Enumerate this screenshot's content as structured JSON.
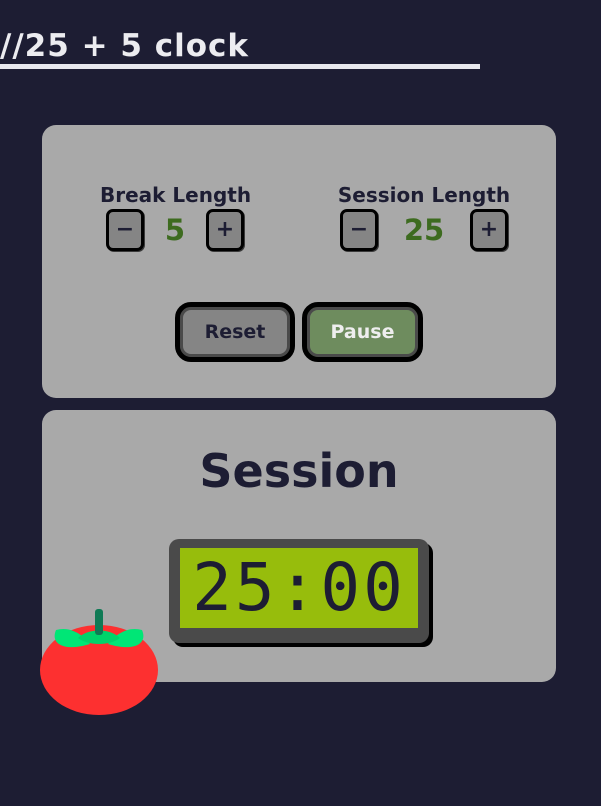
{
  "header": {
    "title": "//25 + 5 clock"
  },
  "settings": {
    "break": {
      "label": "Break Length",
      "value": "5",
      "decrement_label": "−",
      "increment_label": "+"
    },
    "session": {
      "label": "Session Length",
      "value": "25",
      "decrement_label": "−",
      "increment_label": "+"
    },
    "reset_label": "Reset",
    "pause_label": "Pause"
  },
  "timer": {
    "label": "Session",
    "time": "25:00"
  },
  "icons": {
    "tomato": "tomato-icon"
  },
  "colors": {
    "background": "#1d1d33",
    "panel": "#a9a9a9",
    "value_green": "#3d6b1f",
    "lcd_screen": "#97bd0c",
    "pause_button": "#6e8c5e",
    "tomato_red": "#fd3030",
    "leaf_green": "#00e676"
  }
}
